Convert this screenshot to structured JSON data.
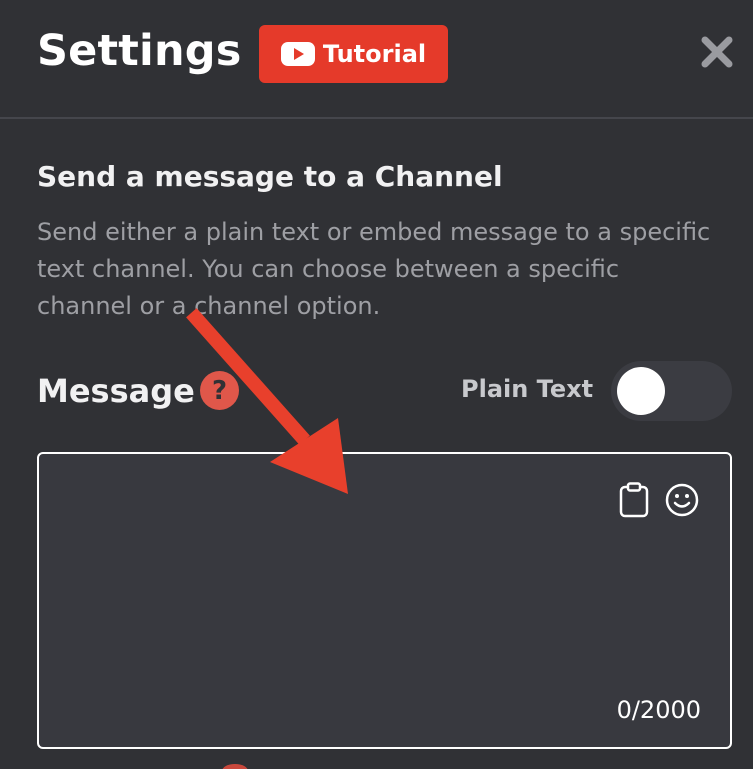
{
  "header": {
    "title": "Settings",
    "tutorial_label": "Tutorial",
    "close_icon": "close-icon"
  },
  "section": {
    "heading": "Send a message to a Channel",
    "description": "Send either a plain text or embed message to a specific text channel. You can choose between a specific channel or a channel option."
  },
  "message": {
    "label": "Message",
    "help_icon": "question-mark-icon",
    "plain_text_label": "Plain Text",
    "plain_text_toggle_on": false,
    "placeholder": "",
    "value": "",
    "char_count": "0/2000",
    "icons": [
      "clipboard-icon",
      "emoji-icon"
    ]
  },
  "annotation": {
    "arrow_color": "#e8402c"
  },
  "colors": {
    "background": "#303135",
    "accent": "#e53a2a",
    "text_primary": "#ffffff",
    "text_secondary": "#9e9fa4"
  }
}
